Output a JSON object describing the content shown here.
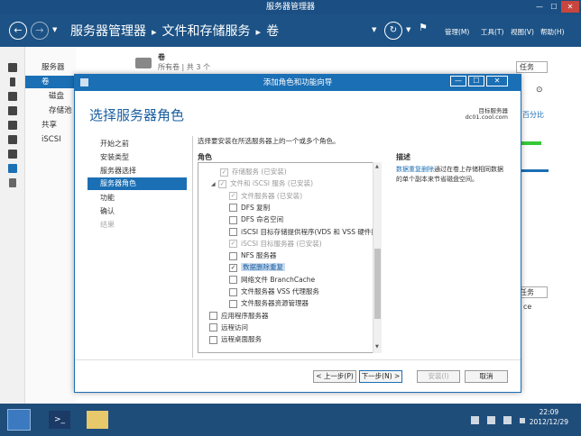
{
  "window": {
    "title": "服务器管理器",
    "controls": [
      "—",
      "☐",
      "✕"
    ]
  },
  "nav": {
    "breadcrumb": [
      "服务器管理器",
      "文件和存储服务",
      "卷"
    ],
    "menu": [
      "管理(M)",
      "工具(T)",
      "视图(V)",
      "帮助(H)"
    ]
  },
  "sidebar": {
    "items": [
      "服务器",
      "卷",
      "磁盘",
      "存储池",
      "共享",
      "iSCSI"
    ]
  },
  "background": {
    "volume_title": "卷",
    "volume_subtitle": "所有卷 | 共 3 个",
    "tasks_label": "任务",
    "tasks_label2": "任务",
    "partial_link": "百分比",
    "partial_text": "ce"
  },
  "dialog": {
    "title": "添加角色和功能向导",
    "heading": "选择服务器角色",
    "target_label": "目标服务器",
    "target_server": "dc01.cool.com",
    "instruction": "选择要安装在所选服务器上的一个或多个角色。",
    "roles_header": "角色",
    "description_header": "描述",
    "description_link": "数据重复删除",
    "description_text": "通过在卷上存储相同数据的单个副本来节省磁盘空间。",
    "steps": [
      "开始之前",
      "安装类型",
      "服务器选择",
      "服务器角色",
      "功能",
      "确认",
      "结果"
    ],
    "roles": [
      {
        "label": "存储服务 (已安装)",
        "checked": true,
        "dim": true,
        "indent": 1,
        "expander": ""
      },
      {
        "label": "文件和 iSCSI 服务 (已安装)",
        "checked": true,
        "dim": true,
        "indent": 0,
        "expander": "◢"
      },
      {
        "label": "文件服务器 (已安装)",
        "checked": true,
        "dim": true,
        "indent": 2,
        "expander": ""
      },
      {
        "label": "DFS 复制",
        "checked": false,
        "dim": false,
        "indent": 2,
        "expander": ""
      },
      {
        "label": "DFS 命名空间",
        "checked": false,
        "dim": false,
        "indent": 2,
        "expander": ""
      },
      {
        "label": "iSCSI 目标存储提供程序(VDS 和 VSS 硬件提",
        "checked": false,
        "dim": false,
        "indent": 2,
        "expander": ""
      },
      {
        "label": "iSCSI 目标服务器 (已安装)",
        "checked": true,
        "dim": true,
        "indent": 2,
        "expander": ""
      },
      {
        "label": "NFS 服务器",
        "checked": false,
        "dim": false,
        "indent": 2,
        "expander": ""
      },
      {
        "label": "数据删除重复",
        "checked": true,
        "dim": false,
        "indent": 2,
        "expander": "",
        "selected": true
      },
      {
        "label": "网络文件 BranchCache",
        "checked": false,
        "dim": false,
        "indent": 2,
        "expander": ""
      },
      {
        "label": "文件服务器 VSS 代理服务",
        "checked": false,
        "dim": false,
        "indent": 2,
        "expander": ""
      },
      {
        "label": "文件服务器资源管理器",
        "checked": false,
        "dim": false,
        "indent": 2,
        "expander": ""
      },
      {
        "label": "应用程序服务器",
        "checked": false,
        "dim": false,
        "indent": -1,
        "expander": ""
      },
      {
        "label": "远程访问",
        "checked": false,
        "dim": false,
        "indent": -1,
        "expander": ""
      },
      {
        "label": "远程桌面服务",
        "checked": false,
        "dim": false,
        "indent": -1,
        "expander": ""
      }
    ],
    "buttons": {
      "prev": "< 上一步(P)",
      "next": "下一步(N) >",
      "install": "安装(I)",
      "cancel": "取消"
    }
  },
  "taskbar": {
    "time": "22:09",
    "date": "2012/12/29"
  }
}
